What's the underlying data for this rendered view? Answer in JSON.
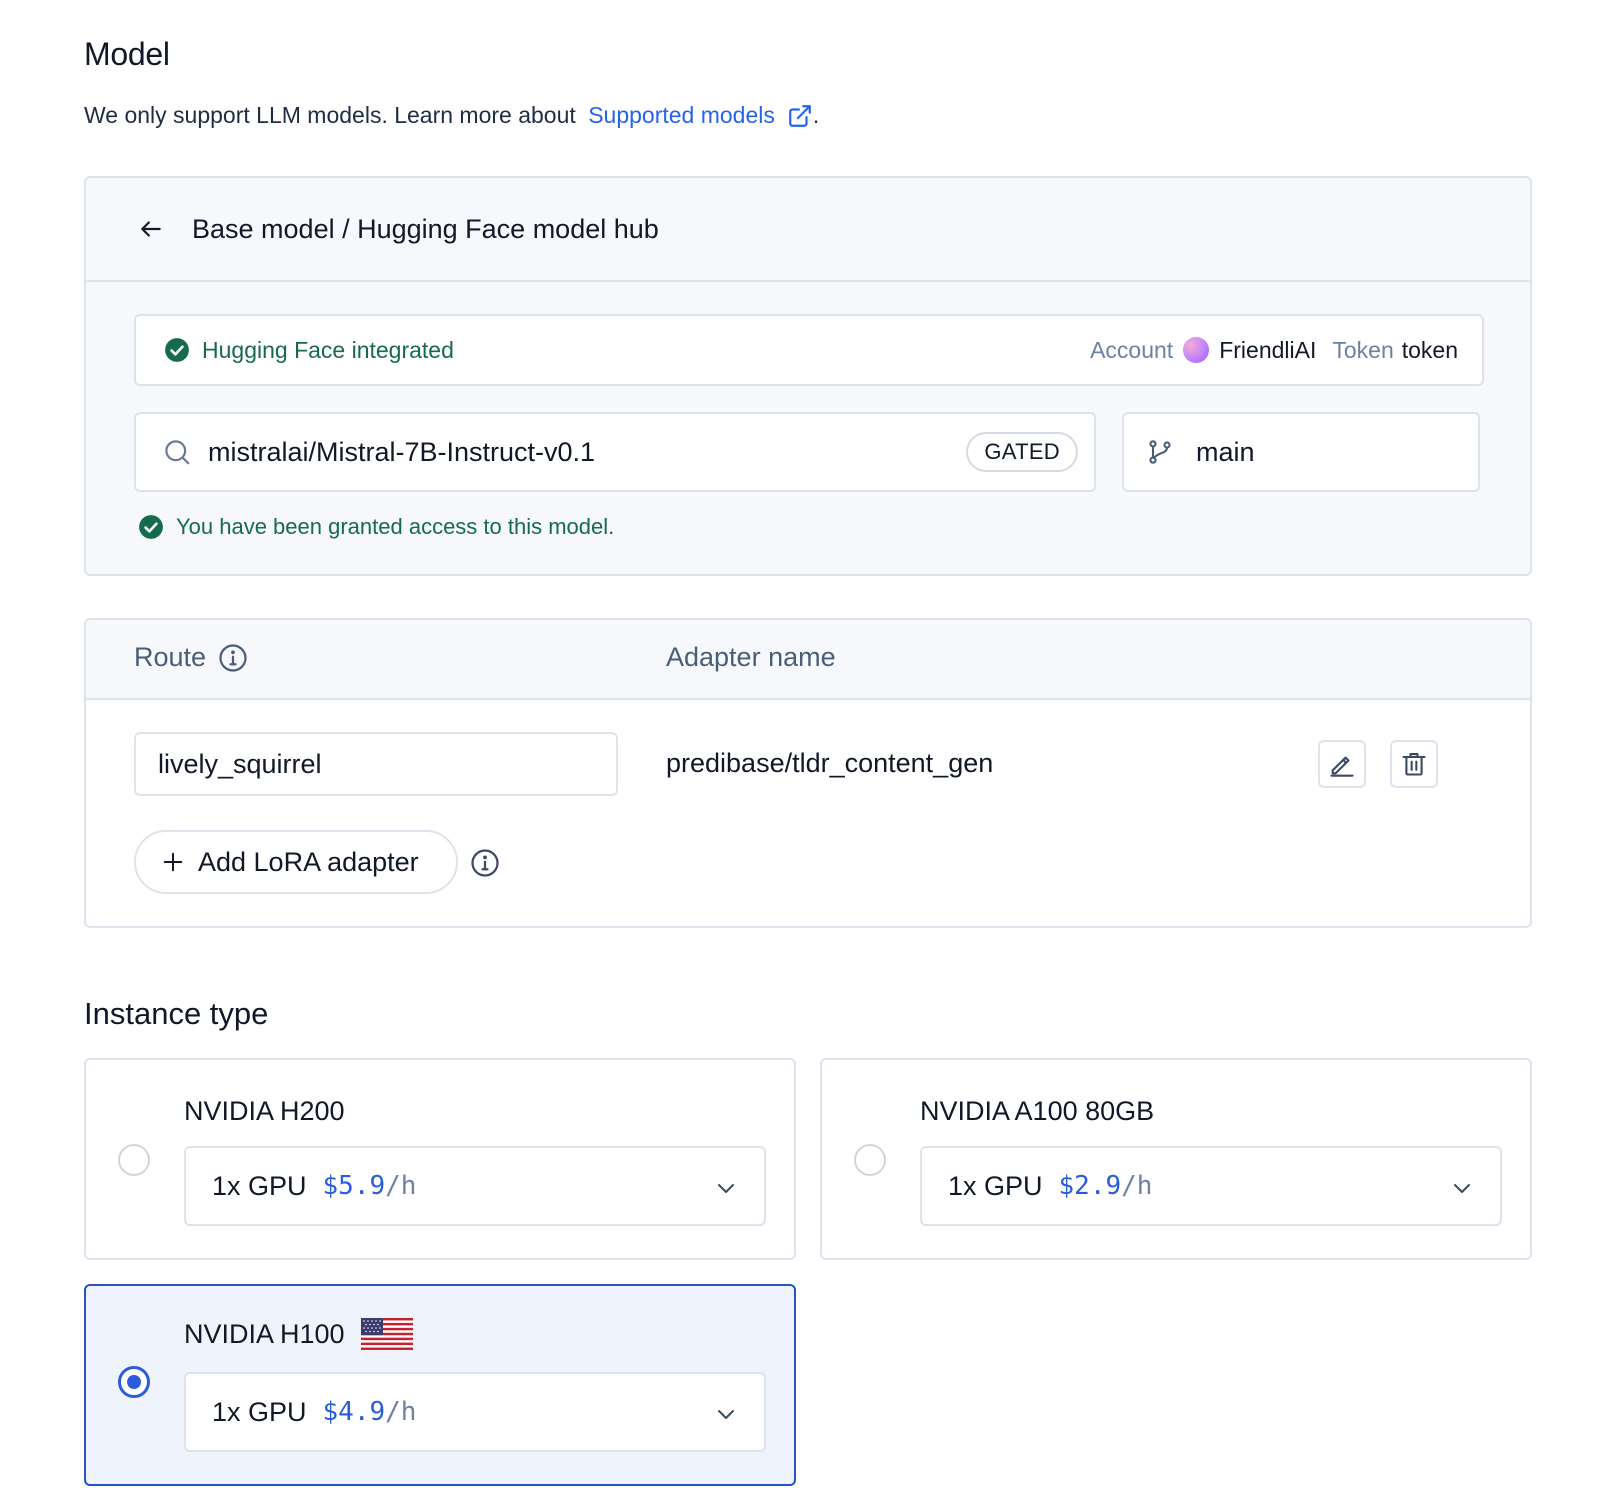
{
  "model_section": {
    "title": "Model",
    "subtitle_prefix": "We only support LLM models. Learn more about ",
    "link_label": "Supported models",
    "subtitle_suffix": "."
  },
  "base_model": {
    "breadcrumb": "Base model / Hugging Face model hub",
    "integration_status": "Hugging Face integrated",
    "account_label": "Account",
    "account_name": "FriendliAI",
    "token_label": "Token",
    "token_value": "token",
    "search_value": "mistralai/Mistral-7B-Instruct-v0.1",
    "gated_badge": "GATED",
    "branch_value": "main",
    "access_message": "You have been granted access to this model."
  },
  "adapters": {
    "col_route": "Route",
    "col_adapter": "Adapter name",
    "rows": [
      {
        "route": "lively_squirrel",
        "adapter": "predibase/tldr_content_gen"
      }
    ],
    "add_label": "Add LoRA adapter"
  },
  "instance_section": {
    "title": "Instance type",
    "cards": [
      {
        "name": "NVIDIA H200",
        "gpu": "1x GPU",
        "price": "$5.9",
        "unit": "/h",
        "selected": false
      },
      {
        "name": "NVIDIA A100 80GB",
        "gpu": "1x GPU",
        "price": "$2.9",
        "unit": "/h",
        "selected": false
      },
      {
        "name": "NVIDIA H100",
        "gpu": "1x GPU",
        "price": "$4.9",
        "unit": "/h",
        "selected": true,
        "flag": "us-flag-icon"
      }
    ]
  },
  "colors": {
    "accent": "#2563eb",
    "success": "#166b4e",
    "border": "#dde3ec",
    "selected_bg": "#eef3fc"
  }
}
